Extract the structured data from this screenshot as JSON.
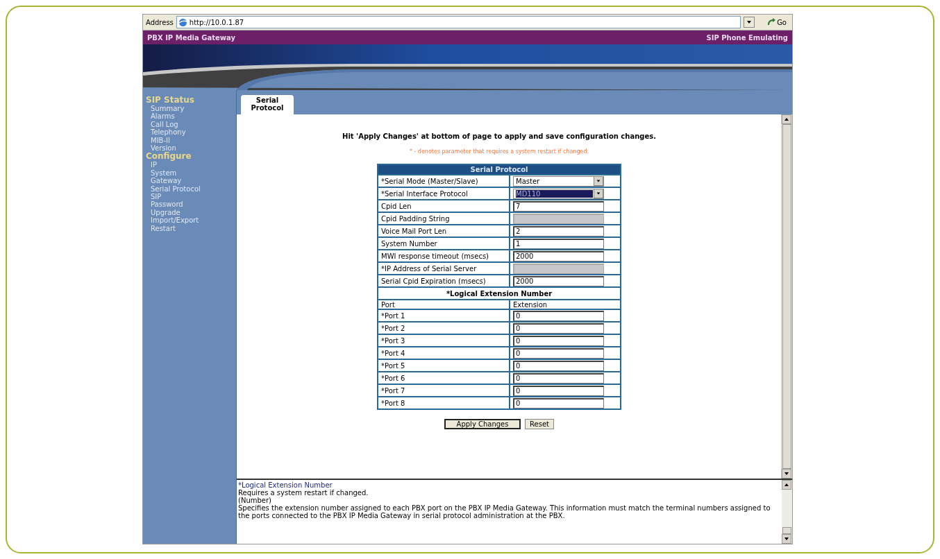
{
  "address_bar": {
    "label": "Address",
    "url": "http://10.0.1.87",
    "go_label": "Go"
  },
  "header": {
    "title": "PBX IP Media Gateway",
    "mode": "SIP Phone Emulating"
  },
  "sidebar": {
    "sections": [
      {
        "heading": "SIP Status",
        "items": [
          "Summary",
          "Alarms",
          "Call Log",
          "Telephony",
          "MIB-II",
          "Version"
        ]
      },
      {
        "heading": "Configure",
        "items": [
          "IP",
          "System",
          "Gateway",
          "Serial Protocol",
          "SIP",
          "Password",
          "Upgrade",
          "Import/Export",
          "Restart"
        ]
      }
    ]
  },
  "tabs": [
    {
      "label": "Serial Protocol",
      "selected": true
    }
  ],
  "instructions": "Hit 'Apply Changes' at bottom of page to apply and save configuration changes.",
  "restart_note": "* - denotes parameter that requires a system restart if changed.",
  "form": {
    "title": "Serial Protocol",
    "fields": [
      {
        "label": "*Serial Mode (Master/Slave)",
        "kind": "select",
        "value": "Master",
        "highlighted": false
      },
      {
        "label": "*Serial Interface Protocol",
        "kind": "select",
        "value": "MD110",
        "highlighted": true
      },
      {
        "label": "Cpid Len",
        "kind": "text",
        "value": "7",
        "disabled": false
      },
      {
        "label": "Cpid Padding String",
        "kind": "text",
        "disabled": true
      },
      {
        "label": "Voice Mail Port Len",
        "kind": "text",
        "value": "2",
        "disabled": false
      },
      {
        "label": "System Number",
        "kind": "text",
        "value": "1",
        "disabled": false
      },
      {
        "label": "MWI response timeout (msecs)",
        "kind": "text",
        "value": "2000",
        "disabled": false
      },
      {
        "label": "*IP Address of Serial Server",
        "kind": "text",
        "disabled": true
      },
      {
        "label": "Serial Cpid Expiration (msecs)",
        "kind": "text",
        "value": "2000",
        "disabled": false
      }
    ],
    "extension_section": {
      "title": "*Logical Extension Number",
      "columns": [
        "Port",
        "Extension"
      ],
      "rows": [
        {
          "port": "*Port 1",
          "value": "0"
        },
        {
          "port": "*Port 2",
          "value": "0"
        },
        {
          "port": "*Port 3",
          "value": "0"
        },
        {
          "port": "*Port 4",
          "value": "0"
        },
        {
          "port": "*Port 5",
          "value": "0"
        },
        {
          "port": "*Port 6",
          "value": "0"
        },
        {
          "port": "*Port 7",
          "value": "0"
        },
        {
          "port": "*Port 8",
          "value": "0"
        }
      ]
    }
  },
  "buttons": [
    {
      "label": "Apply Changes",
      "default": true
    },
    {
      "label": "Reset",
      "default": false
    }
  ],
  "help": {
    "title": "*Logical Extension Number",
    "lines": [
      "Requires a system restart if changed.",
      "(Number)",
      "Specifies the extension number assigned to each PBX port on the PBX IP Media Gateway. This information must match the terminal numbers assigned to the ports connected to the PBX IP Media Gateway in serial protocol administration at the PBX."
    ]
  }
}
